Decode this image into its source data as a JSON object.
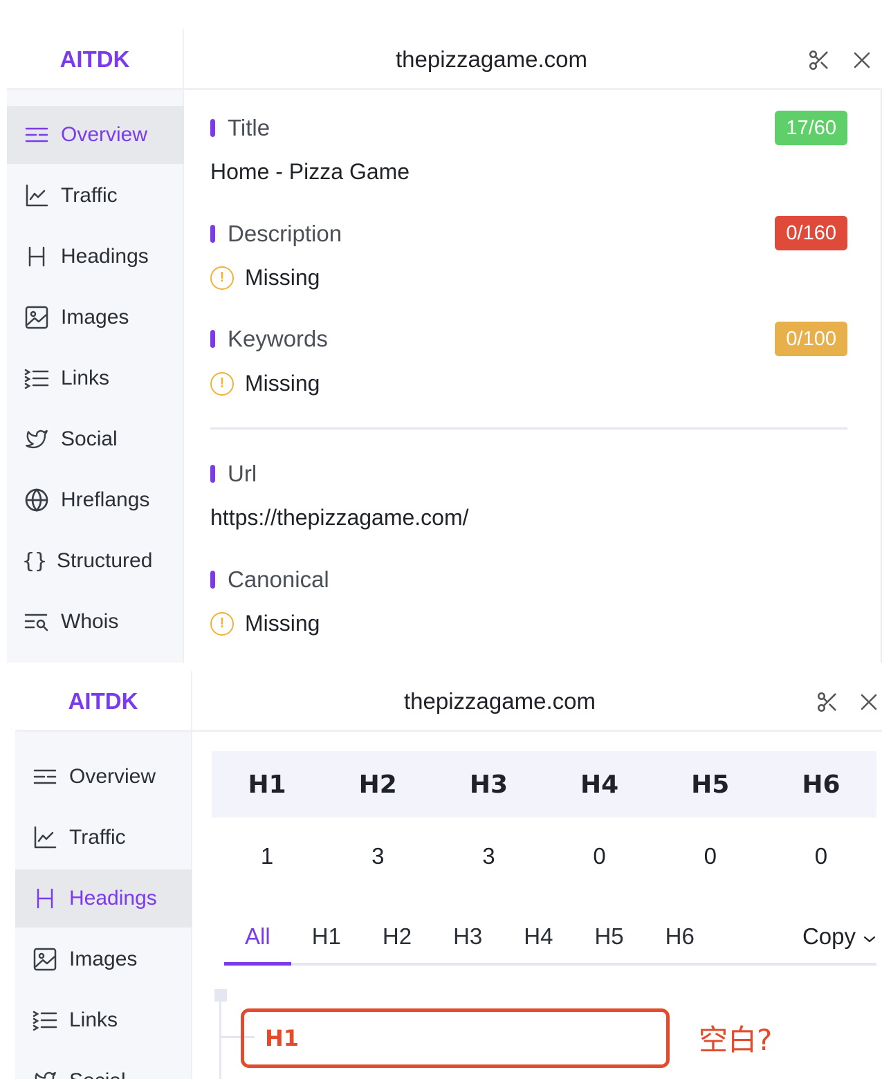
{
  "brand": "AITDK",
  "site": "thepizzagame.com",
  "colors": {
    "accent": "#7c3aed",
    "green": "#5fcf6a",
    "red": "#e04a3b",
    "orange": "#e8b04b",
    "warn": "#f0b23a",
    "annotation": "#e24b2b"
  },
  "icons": {
    "scissors": "scissors-icon",
    "close": "close-icon"
  },
  "nav": [
    {
      "label": "Overview",
      "icon": "overview-icon"
    },
    {
      "label": "Traffic",
      "icon": "traffic-chart-icon"
    },
    {
      "label": "Headings",
      "icon": "heading-icon"
    },
    {
      "label": "Images",
      "icon": "image-icon"
    },
    {
      "label": "Links",
      "icon": "links-list-icon"
    },
    {
      "label": "Social",
      "icon": "twitter-icon"
    },
    {
      "label": "Hreflangs",
      "icon": "globe-icon"
    },
    {
      "label": "Structured",
      "icon": "braces-icon"
    },
    {
      "label": "Whois",
      "icon": "whois-search-icon"
    }
  ],
  "overview": {
    "title": {
      "label": "Title",
      "value": "Home - Pizza Game",
      "badge": "17/60"
    },
    "description": {
      "label": "Description",
      "value": "Missing",
      "badge": "0/160"
    },
    "keywords": {
      "label": "Keywords",
      "value": "Missing",
      "badge": "0/100"
    },
    "url": {
      "label": "Url",
      "value": "https://thepizzagame.com/"
    },
    "canonical": {
      "label": "Canonical",
      "value": "Missing"
    }
  },
  "headings": {
    "columns": [
      "H1",
      "H2",
      "H3",
      "H4",
      "H5",
      "H6"
    ],
    "counts": [
      "1",
      "3",
      "3",
      "0",
      "0",
      "0"
    ],
    "tabs": [
      "All",
      "H1",
      "H2",
      "H3",
      "H4",
      "H5",
      "H6"
    ],
    "copy_label": "Copy",
    "tree_item_tag": "H1",
    "annotation": "空白?"
  }
}
